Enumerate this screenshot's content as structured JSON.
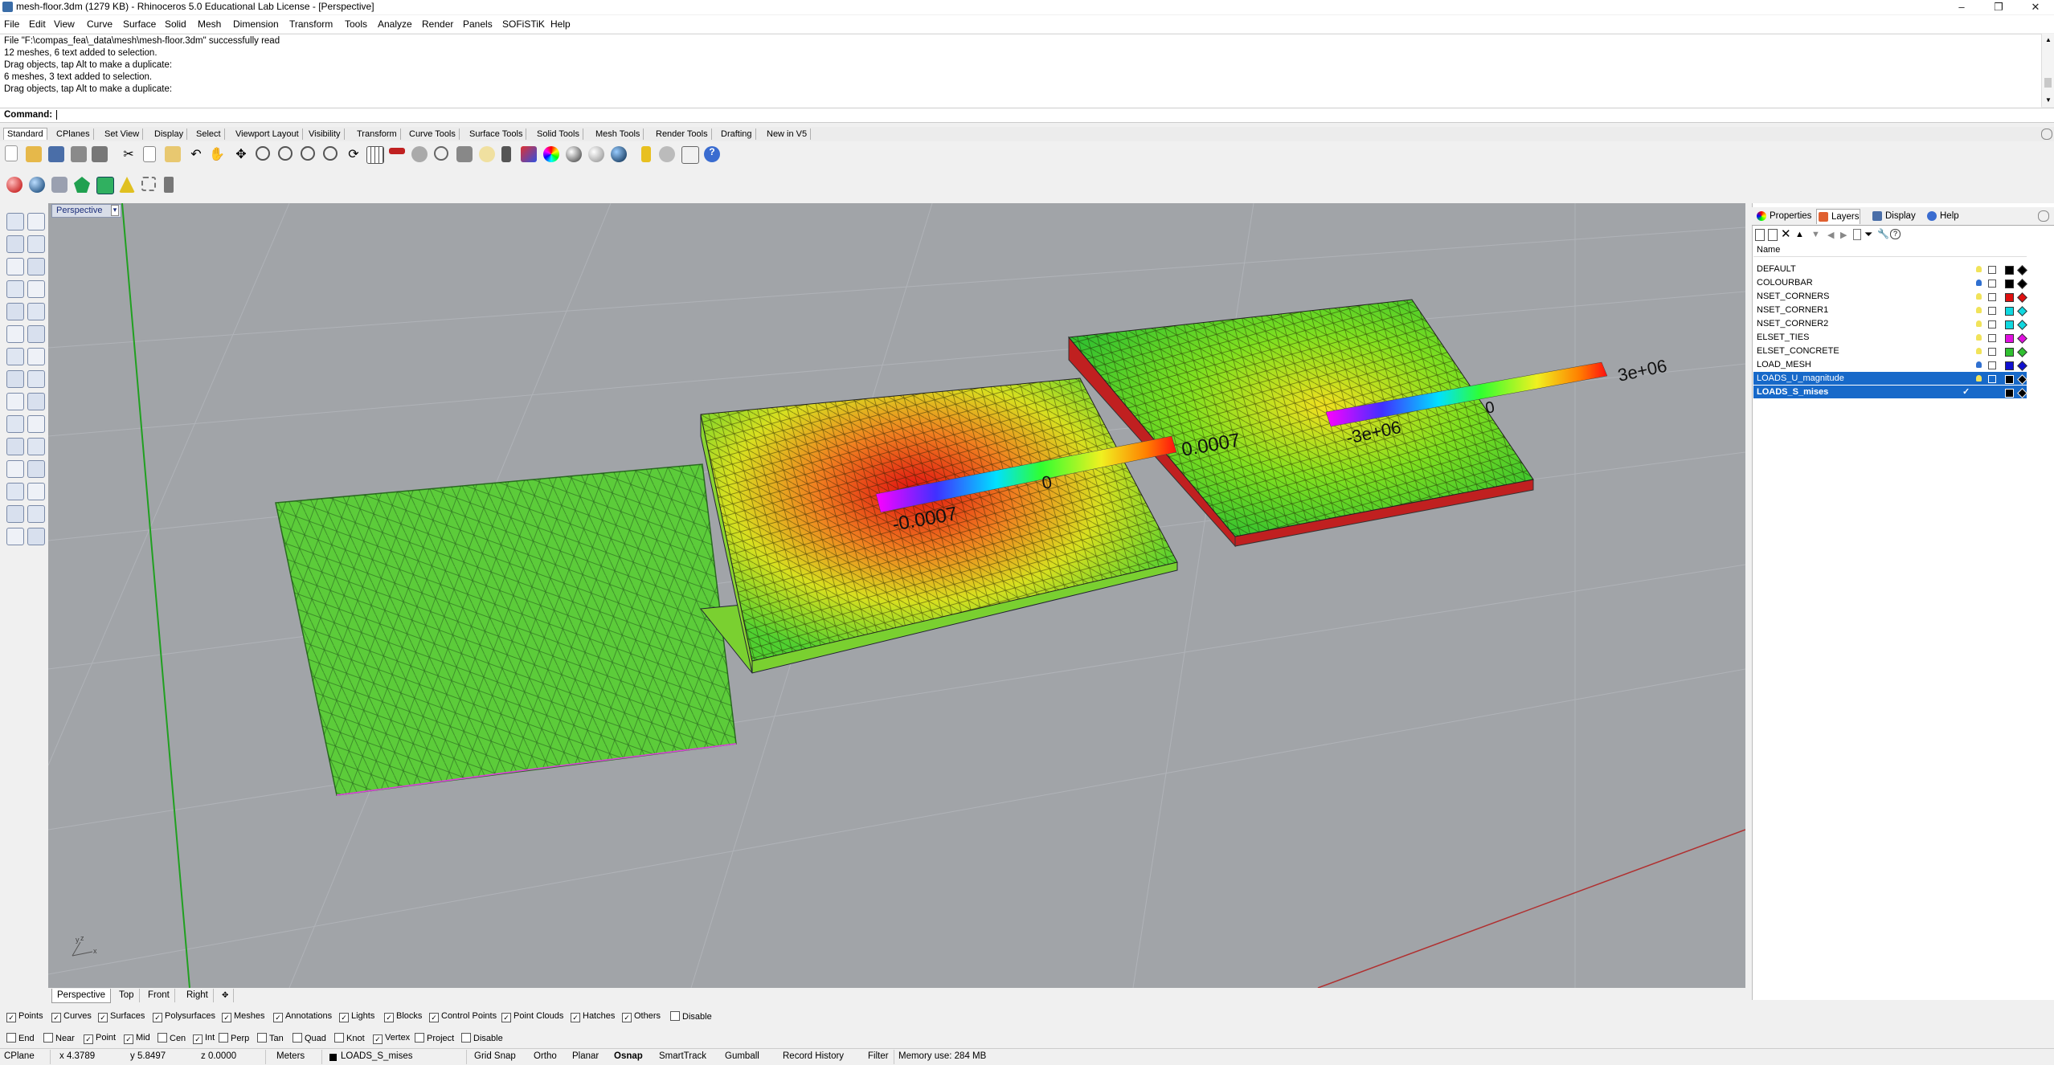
{
  "window": {
    "title": "mesh-floor.3dm (1279 KB) - Rhinoceros 5.0 Educational Lab License - [Perspective]",
    "controls": [
      "–",
      "❐",
      "✕"
    ]
  },
  "menu": [
    "File",
    "Edit",
    "View",
    "Curve",
    "Surface",
    "Solid",
    "Mesh",
    "Dimension",
    "Transform",
    "Tools",
    "Analyze",
    "Render",
    "Panels",
    "SOFiSTiK",
    "Help"
  ],
  "history": [
    "File \"F:\\compas_fea\\_data\\mesh\\mesh-floor.3dm\" successfully read",
    "12 meshes, 6 text added to selection.",
    "Drag objects, tap Alt to make a duplicate:",
    "6 meshes, 3 text added to selection.",
    "Drag objects, tap Alt to make a duplicate:"
  ],
  "command": {
    "label": "Command:",
    "value": ""
  },
  "toolbar_tabs": [
    "Standard",
    "CPlanes",
    "Set View",
    "Display",
    "Select",
    "Viewport Layout",
    "Visibility",
    "Transform",
    "Curve Tools",
    "Surface Tools",
    "Solid Tools",
    "Mesh Tools",
    "Render Tools",
    "Drafting",
    "New in V5"
  ],
  "viewport": {
    "title": "Perspective",
    "colorbar1": {
      "min": "-0.0007",
      "mid": "0",
      "max": "0.0007"
    },
    "colorbar2": {
      "min": "-3e+06",
      "mid": "0",
      "max": "3e+06"
    },
    "axes": {
      "x": "x",
      "y": "y",
      "z": "z"
    }
  },
  "viewport_tabs": [
    "Perspective",
    "Top",
    "Front",
    "Right"
  ],
  "panel": {
    "tabs": [
      "Properties",
      "Layers",
      "Display",
      "Help"
    ],
    "column_name": "Name",
    "layers": [
      {
        "name": "DEFAULT",
        "color": "#000000",
        "selected": false
      },
      {
        "name": "COLOURBAR",
        "color": "#000000",
        "selected": false
      },
      {
        "name": "NSET_CORNERS",
        "color": "#e01010",
        "selected": false
      },
      {
        "name": "NSET_CORNER1",
        "color": "#10d8e0",
        "selected": false
      },
      {
        "name": "NSET_CORNER2",
        "color": "#10d8e0",
        "selected": false
      },
      {
        "name": "ELSET_TIES",
        "color": "#e010e0",
        "selected": false
      },
      {
        "name": "ELSET_CONCRETE",
        "color": "#30c030",
        "selected": false
      },
      {
        "name": "LOAD_MESH",
        "color": "#1010d0",
        "selected": false
      },
      {
        "name": "LOADS_U_magnitude",
        "color": "#000000",
        "selected": true
      },
      {
        "name": "LOADS_S_mises",
        "color": "#000000",
        "selected": true
      }
    ]
  },
  "filters": [
    "Points",
    "Curves",
    "Surfaces",
    "Polysurfaces",
    "Meshes",
    "Annotations",
    "Lights",
    "Blocks",
    "Control Points",
    "Point Clouds",
    "Hatches",
    "Others",
    "Disable"
  ],
  "osnaps": [
    {
      "label": "End",
      "checked": false
    },
    {
      "label": "Near",
      "checked": false
    },
    {
      "label": "Point",
      "checked": true
    },
    {
      "label": "Mid",
      "checked": true
    },
    {
      "label": "Cen",
      "checked": false
    },
    {
      "label": "Int",
      "checked": true
    },
    {
      "label": "Perp",
      "checked": false
    },
    {
      "label": "Tan",
      "checked": false
    },
    {
      "label": "Quad",
      "checked": false
    },
    {
      "label": "Knot",
      "checked": false
    },
    {
      "label": "Vertex",
      "checked": true
    },
    {
      "label": "Project",
      "checked": false
    },
    {
      "label": "Disable",
      "checked": false
    }
  ],
  "status": {
    "cplane": "CPlane",
    "x": "x 4.3789",
    "y": "y 5.8497",
    "z": "z 0.0000",
    "units": "Meters",
    "layer": "LOADS_S_mises",
    "toggles": [
      "Grid Snap",
      "Ortho",
      "Planar",
      "Osnap",
      "SmartTrack",
      "Gumball",
      "Record History",
      "Filter"
    ],
    "memory": "Memory use: 284 MB"
  }
}
